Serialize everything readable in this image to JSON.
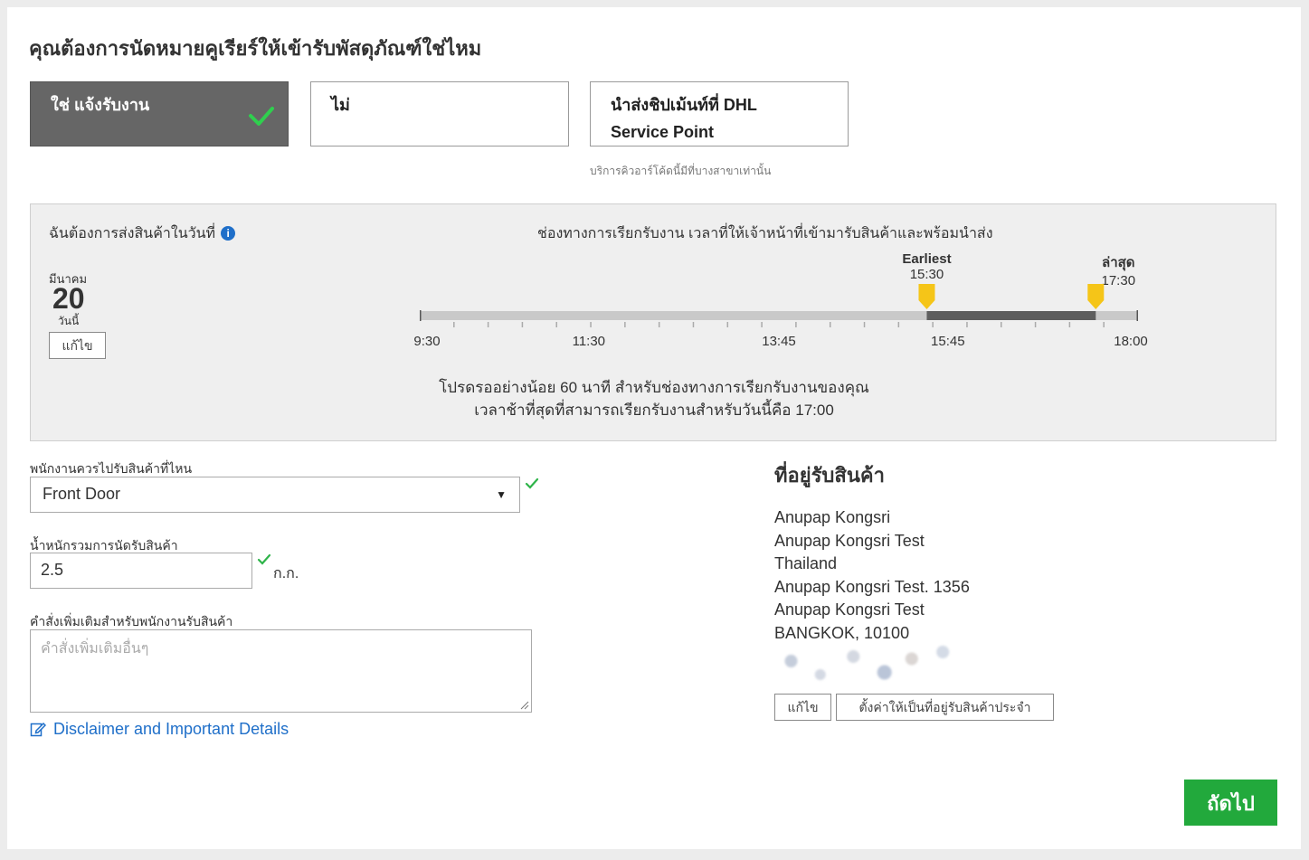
{
  "question": "คุณต้องการนัดหมายคูเรียร์ให้เข้ารับพัสดุภัณฑ์ใช่ไหม",
  "options": [
    {
      "line1": "ใช่ แจ้งรับงาน",
      "line2": "",
      "selected": true
    },
    {
      "line1": "ไม่",
      "line2": "",
      "selected": false
    },
    {
      "line1": "นำส่งชิปเม้นท์ที่ DHL",
      "line2": "Service Point",
      "selected": false
    }
  ],
  "option_note": "บริการคิวอาร์โค้ดนี้มีที่บางสาขาเท่านั้น",
  "schedule": {
    "ship_label": "ฉันต้องการส่งสินค้าในวันที่",
    "info_icon": "i",
    "window_title": "ช่องทางการเรียกรับงาน เวลาที่ให้เจ้าหน้าที่เข้ามารับสินค้าและพร้อมนำส่ง",
    "date": {
      "month": "มีนาคม",
      "day": "20",
      "today": "วันนี้",
      "edit_label": "แก้ไข"
    },
    "earliest": {
      "label": "Earliest",
      "time": "15:30",
      "value": 15.5
    },
    "latest": {
      "label": "ล่าสุด",
      "time": "17:30",
      "value": 17.5
    },
    "range": {
      "start": 9.5,
      "end": 18.0
    },
    "tick_labels": [
      {
        "label": "9:30",
        "value": 9.5
      },
      {
        "label": "11:30",
        "value": 11.5
      },
      {
        "label": "13:45",
        "value": 13.75
      },
      {
        "label": "15:45",
        "value": 15.75
      },
      {
        "label": "18:00",
        "value": 18.0
      }
    ],
    "note_line1": "โปรดรออย่างน้อย 60 นาที สำหรับช่องทางการเรียกรับงานของคุณ",
    "note_line2": "เวลาช้าที่สุดที่สามารถเรียกรับงานสำหรับวันนี้คือ 17:00",
    "marker_color": "#f5c518"
  },
  "form": {
    "location_label": "พนักงานควรไปรับสินค้าที่ไหน",
    "location_value": "Front Door",
    "weight_label": "น้ำหนักรวมการนัดรับสินค้า",
    "weight_value": "2.5",
    "weight_unit": "ก.ก.",
    "instructions_label": "คำสั่งเพิ่มเติมสำหรับพนักงานรับสินค้า",
    "instructions_placeholder": "คำสั่งเพิ่มเติมอื่นๆ",
    "disclaimer": "Disclaimer and Important Details"
  },
  "address": {
    "title": "ที่อยู่รับสินค้า",
    "lines": [
      "Anupap Kongsri",
      "Anupap Kongsri Test",
      "Thailand",
      "Anupap Kongsri Test. 1356",
      "Anupap Kongsri Test",
      "BANGKOK, 10100"
    ],
    "edit_label": "แก้ไข",
    "default_label": "ตั้งค่าให้เป็นที่อยู่รับสินค้าประจำ"
  },
  "next_label": "ถัดไป",
  "colors": {
    "accent": "#22a93c",
    "link": "#1f6fc9",
    "selected": "#666666"
  }
}
